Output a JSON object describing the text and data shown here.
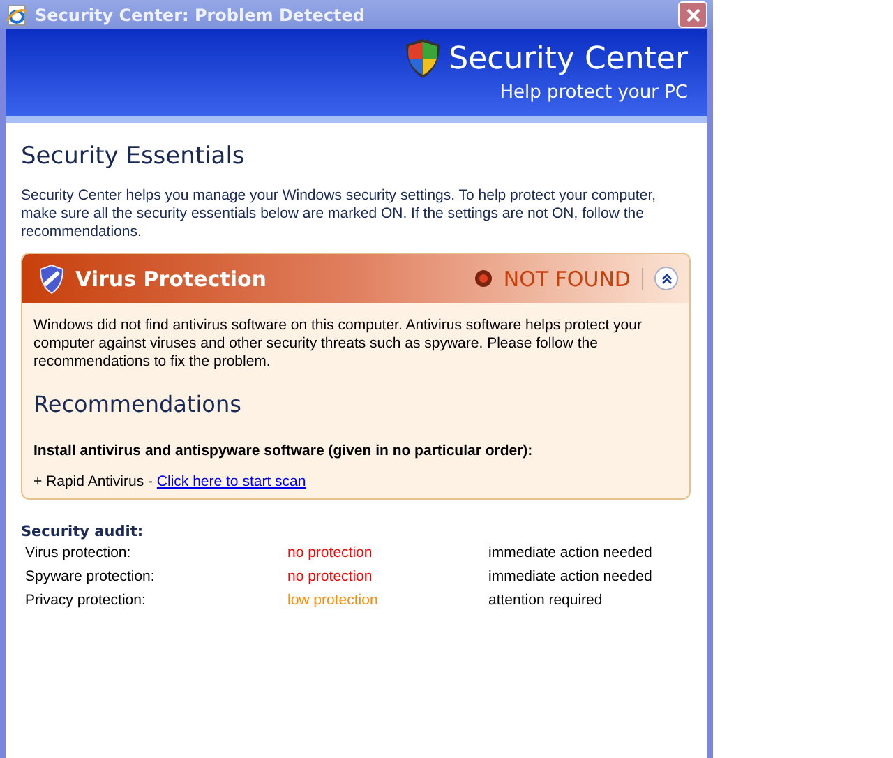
{
  "window": {
    "title": "Security Center: Problem Detected"
  },
  "banner": {
    "title": "Security Center",
    "subtitle": "Help protect your PC"
  },
  "heading": "Security Essentials",
  "intro": "Security Center helps you manage your Windows security settings. To help protect your computer, make sure all the security essentials below are marked ON. If the settings are not ON, follow the recommendations.",
  "panel": {
    "title": "Virus Protection",
    "status": "NOT FOUND",
    "expanded": true,
    "description": "Windows did not find antivirus software on this computer. Antivirus software helps protect your computer against viruses and other security threats such as spyware. Please follow the recommendations to fix the problem.",
    "recommendations_heading": "Recommendations",
    "instruction": "Install antivirus and antispyware software (given in no particular order):",
    "product": "+ Rapid Antivirus -",
    "link": "Click here to start scan"
  },
  "audit": {
    "title": "Security audit:",
    "rows": [
      {
        "name": "Virus protection:",
        "status": "no protection",
        "color": "#ff0000",
        "action": "immediate action needed"
      },
      {
        "name": "Spyware protection:",
        "status": "no protection",
        "color": "#ff0000",
        "action": "immediate action needed"
      },
      {
        "name": "Privacy protection:",
        "status": "low protection",
        "color": "#ff8c00",
        "action": "attention required"
      }
    ]
  }
}
